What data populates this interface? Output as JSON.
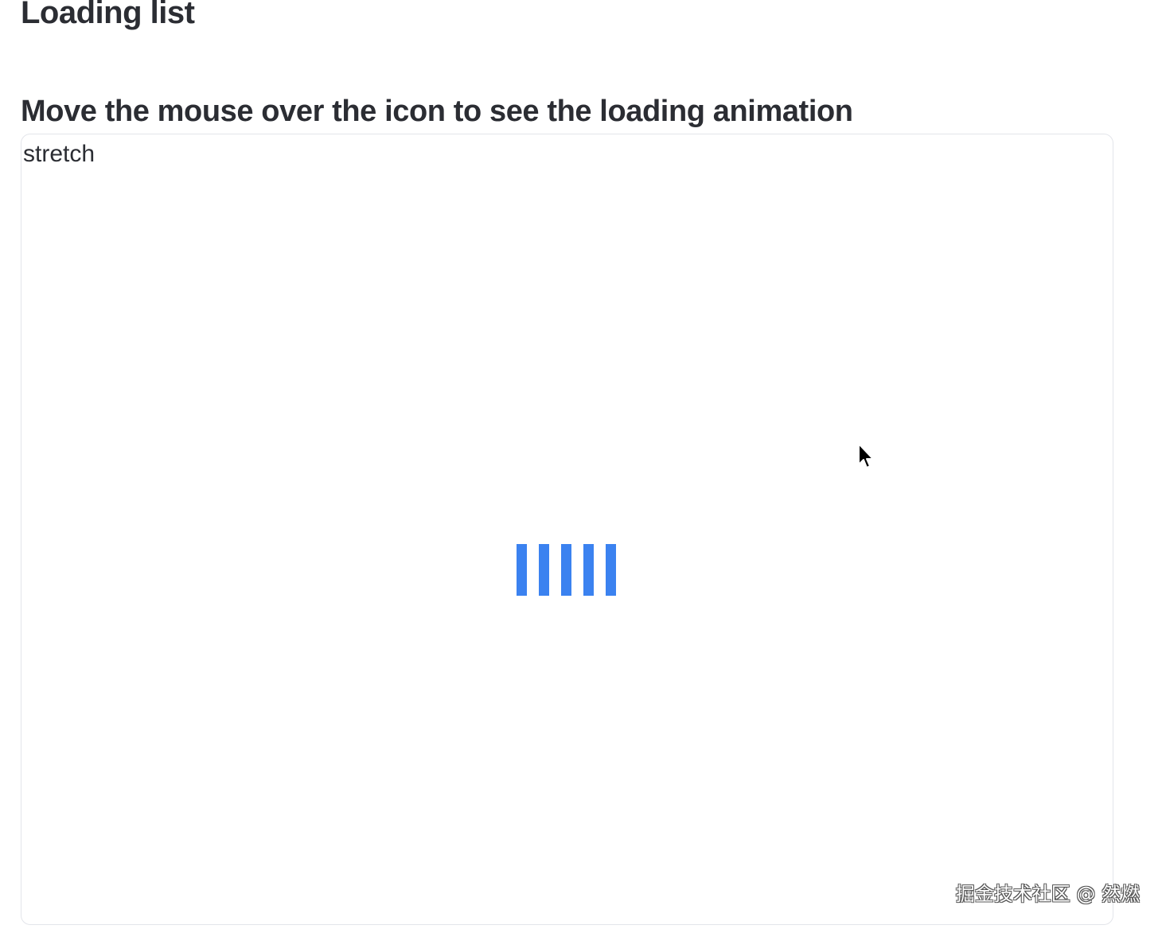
{
  "page": {
    "title": "Loading list"
  },
  "section": {
    "title": "Move the mouse over the icon to see the loading animation"
  },
  "card": {
    "label": "stretch",
    "loader": {
      "icon": "stretch-loading-icon",
      "bar_count": 5,
      "color": "#3b82f0"
    }
  },
  "cursor": {
    "icon": "mouse-pointer-icon"
  },
  "watermark": {
    "text": "掘金技术社区 @ 然燃"
  }
}
